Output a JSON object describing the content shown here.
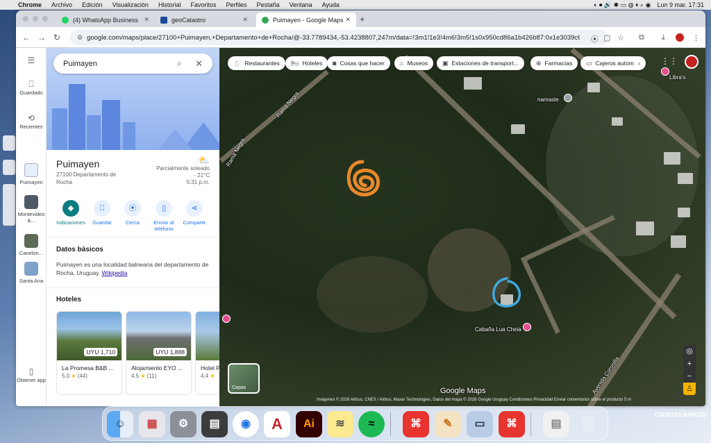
{
  "menubar": {
    "app_name": "Chrome",
    "items": [
      "Archivo",
      "Edición",
      "Visualización",
      "Historial",
      "Favoritos",
      "Perfiles",
      "Pestaña",
      "Ventana",
      "Ayuda"
    ],
    "clock": "Lun 9 mar.  17:31"
  },
  "browser": {
    "tabs": [
      {
        "title": "(4) WhatsApp Business",
        "favicon_color": "#25d366"
      },
      {
        "title": "geoCatastro",
        "favicon_color": "#1a4b9b"
      },
      {
        "title": "Puimayen - Google Maps",
        "favicon_color": "#34a853"
      }
    ],
    "url": "google.com/maps/place/27100+Puimayen,+Departamento+de+Rocha/@-33.7789434,-53.4238807,247m/data=!3m1!1e3!4m6!3m5!1s0x950cd86a1b426b87:0x1e3039c6156760..."
  },
  "rail": {
    "items": [
      {
        "label": "Guardado",
        "icon": "bookmark-icon"
      },
      {
        "label": "Recientes",
        "icon": "history-icon"
      },
      {
        "label": "Puimayen",
        "icon": "place-thumb"
      },
      {
        "label": "Montevideo &...",
        "icon": "place-thumb"
      },
      {
        "label": "Canelon...",
        "icon": "place-thumb"
      },
      {
        "label": "Santa Ana",
        "icon": "place-thumb"
      }
    ],
    "get_app": "Obtener app"
  },
  "panel": {
    "search_value": "Puimayen",
    "title": "Puimayen",
    "address": "27100 Departamento de Rocha",
    "weather": {
      "condition": "Parcialmente soleado · 21°C",
      "time": "5:31 p.m."
    },
    "actions": [
      {
        "label": "Indicaciones",
        "icon": "directions-icon"
      },
      {
        "label": "Guardar",
        "icon": "bookmark-icon"
      },
      {
        "label": "Cerca",
        "icon": "nearby-icon"
      },
      {
        "label": "Enviar al teléfono",
        "icon": "phone-icon"
      },
      {
        "label": "Compartir",
        "icon": "share-icon"
      }
    ],
    "basic_title": "Datos básicos",
    "basic_text": "Puimayen es una localidad balnearia del departamento de Rocha, Uruguay.",
    "basic_link": "Wikipedia",
    "hotels_title": "Hoteles",
    "hotels": [
      {
        "name": "La Promesa B&B ...",
        "price": "UYU 1,710",
        "rating": "5.0",
        "reviews": "(44)"
      },
      {
        "name": "Alojamiento EYO ...",
        "price": "UYU 1,888",
        "rating": "4.5",
        "reviews": "(11)"
      },
      {
        "name": "Hotel P...",
        "price": "",
        "rating": "4.4",
        "reviews": ""
      }
    ]
  },
  "map": {
    "chips": [
      {
        "label": "Restaurantes",
        "icon": "fork-knife-icon"
      },
      {
        "label": "Hoteles",
        "icon": "bed-icon"
      },
      {
        "label": "Cosas que hacer",
        "icon": "camera-icon"
      },
      {
        "label": "Museos",
        "icon": "museum-icon"
      },
      {
        "label": "Estaciones de transport...",
        "icon": "bus-icon"
      },
      {
        "label": "Farmacias",
        "icon": "pharmacy-icon"
      },
      {
        "label": "Cajeros autom",
        "icon": "atm-icon"
      }
    ],
    "labels": {
      "road1": "Rama Negra",
      "road2": "Rama Negra",
      "road3": "Avenida Coronilla",
      "namaste": "namaste",
      "libra": "Libra's",
      "cabana": "Cabaña Lua Cheia"
    },
    "layers_label": "Capas",
    "logo": "Google Maps",
    "attribution": "Imágenes © 2026 Airbus, CNES / Airbus, Maxar Technologies, Datos del mapa © 2026 Google   Uruguay   Condiciones   Privacidad   Enviar comentarios sobre el producto   5 m",
    "annotations": {
      "orange": "#e8892b",
      "blue": "#3fa9e0"
    }
  },
  "desktop": {
    "right_label": "CUENTAS BANCOS"
  },
  "dock": {
    "apps": [
      "Finder",
      "Launchpad",
      "System Settings",
      "Calculator",
      "Chrome",
      "AutoCAD",
      "Illustrator",
      "Notes",
      "Spotify",
      "Acrobat",
      "Pages",
      "Preview",
      "Acrobat",
      "Document",
      "Trash"
    ]
  }
}
